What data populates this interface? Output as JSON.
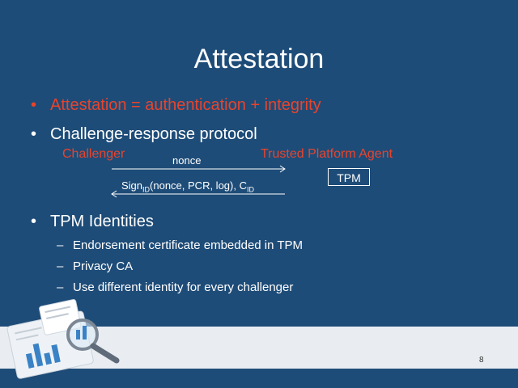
{
  "slide": {
    "title": "Attestation",
    "bullets": [
      {
        "text": "Attestation = authentication + integrity",
        "color": "#e8442c"
      },
      {
        "text": "Challenge-response protocol",
        "color": "#ffffff"
      },
      {
        "text": "TPM Identities",
        "color": "#ffffff"
      }
    ],
    "sub_bullets": [
      "Endorsement certificate embedded in TPM",
      "Privacy CA",
      "Use different identity for every challenger"
    ],
    "diagram": {
      "challenger": "Challenger",
      "agent": "Trusted Platform Agent",
      "message1": "nonce",
      "message2_prefix": "Sign",
      "message2_sub": "ID",
      "message2_mid": "(nonce, PCR, log), C",
      "message2_sub2": "ID",
      "tpm": "TPM"
    },
    "page_number": "8"
  },
  "colors": {
    "background": "#1e4c78",
    "accent": "#e8442c",
    "footer": "#e9edf1"
  },
  "icons": {
    "decorative": "chart-magnifier-icon"
  }
}
